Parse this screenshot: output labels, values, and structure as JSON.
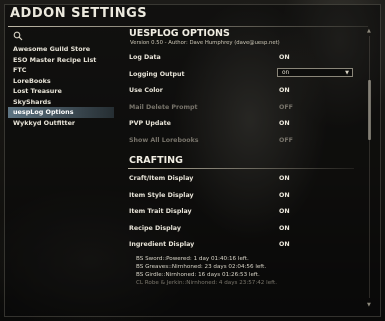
{
  "window": {
    "title": "ADDON SETTINGS"
  },
  "sidebar": {
    "items": [
      {
        "label": "Awesome Guild Store"
      },
      {
        "label": "ESO Master Recipe List"
      },
      {
        "label": "FTC"
      },
      {
        "label": "LoreBooks"
      },
      {
        "label": "Lost Treasure"
      },
      {
        "label": "SkyShards"
      },
      {
        "label": "uespLog Options",
        "selected": true
      },
      {
        "label": "Wykkyd Outfitter"
      }
    ]
  },
  "options": {
    "title": "UESPLOG OPTIONS",
    "subtitle": "Version 0.50 - Author: Dave Humphrey (dave@uesp.net)",
    "rows": [
      {
        "label": "Log Data",
        "value": "ON"
      },
      {
        "label": "Logging Output",
        "value": "on",
        "type": "dropdown"
      },
      {
        "label": "Use Color",
        "value": "ON"
      },
      {
        "label": "Mail Delete Prompt",
        "value": "OFF",
        "disabled": true
      },
      {
        "label": "PVP Update",
        "value": "ON"
      },
      {
        "label": "Show All Lorebooks",
        "value": "OFF",
        "disabled": true
      }
    ]
  },
  "crafting": {
    "title": "CRAFTING",
    "rows": [
      {
        "label": "Craft/Item Display",
        "value": "ON"
      },
      {
        "label": "Item Style Display",
        "value": "ON"
      },
      {
        "label": "Item Trait Display",
        "value": "ON"
      },
      {
        "label": "Recipe Display",
        "value": "ON"
      },
      {
        "label": "Ingredient Display",
        "value": "ON"
      }
    ],
    "timers": [
      "BS Sword::Powered: 1 day 01:40:16 left.",
      "BS Greaves::Nirnhoned: 23 days 02:04:56 left.",
      "BS Girdle::Nirnhoned: 16 days 01:26:53 left.",
      "CL Robe & Jerkin::Nirnhoned: 4 days 23:57:42 left."
    ]
  },
  "colors": {
    "selected_item": "#6f8ea0",
    "disabled_text": "#77736a"
  }
}
